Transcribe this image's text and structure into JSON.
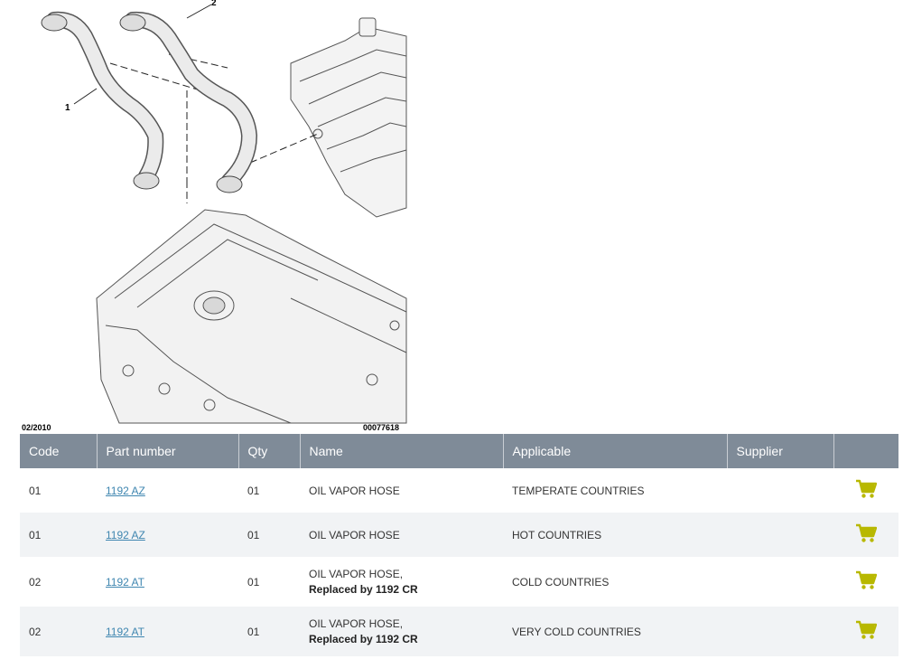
{
  "diagram": {
    "date": "02/2010",
    "code": "00077618",
    "callouts": [
      "1",
      "2"
    ]
  },
  "table": {
    "headers": [
      "Code",
      "Part number",
      "Qty",
      "Name",
      "Applicable",
      "Supplier",
      ""
    ],
    "rows": [
      {
        "code": "01",
        "part": "1192 AZ",
        "qty": "01",
        "name": "OIL VAPOR HOSE",
        "name_note": "",
        "applicable": "TEMPERATE COUNTRIES",
        "supplier": ""
      },
      {
        "code": "01",
        "part": "1192 AZ",
        "qty": "01",
        "name": "OIL VAPOR HOSE",
        "name_note": "",
        "applicable": "HOT COUNTRIES",
        "supplier": ""
      },
      {
        "code": "02",
        "part": "1192 AT",
        "qty": "01",
        "name": "OIL VAPOR HOSE,",
        "name_note": "Replaced by 1192 CR",
        "applicable": "COLD COUNTRIES",
        "supplier": ""
      },
      {
        "code": "02",
        "part": "1192 AT",
        "qty": "01",
        "name": "OIL VAPOR HOSE,",
        "name_note": "Replaced by 1192 CR",
        "applicable": "VERY COLD COUNTRIES",
        "supplier": ""
      }
    ]
  },
  "colors": {
    "header_bg": "#7f8b98",
    "link": "#3f86b0",
    "cart": "#b8b800"
  },
  "icons": {
    "cart": "shopping-cart-icon"
  }
}
